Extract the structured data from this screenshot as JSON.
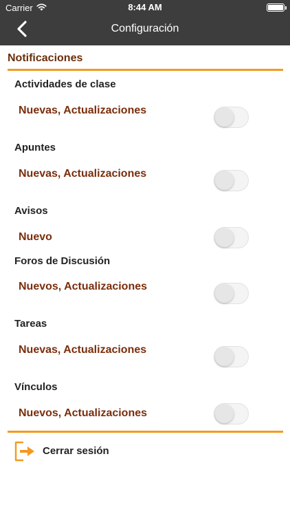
{
  "status_bar": {
    "carrier": "Carrier",
    "time": "8:44 AM",
    "wifi_icon": "wifi-icon",
    "battery_icon": "battery-icon"
  },
  "nav": {
    "title": "Configuración",
    "back_icon": "chevron-left-icon"
  },
  "section": {
    "title": "Notificaciones"
  },
  "groups": [
    {
      "label": "Actividades de clase",
      "option": "Nuevas, Actualizaciones",
      "enabled": false
    },
    {
      "label": "Apuntes",
      "option": "Nuevas, Actualizaciones",
      "enabled": false
    },
    {
      "label": "Avisos",
      "option": "Nuevo",
      "enabled": false
    },
    {
      "label": "Foros de Discusión",
      "option": "Nuevos, Actualizaciones",
      "enabled": false
    },
    {
      "label": "Tareas",
      "option": "Nuevas, Actualizaciones",
      "enabled": false
    },
    {
      "label": "Vínculos",
      "option": "Nuevos, Actualizaciones",
      "enabled": false
    }
  ],
  "logout": {
    "label": "Cerrar sesión",
    "icon": "logout-icon"
  },
  "colors": {
    "nav_bar": "#3d3d3d",
    "accent": "#f29a1f",
    "section_title": "#6b2e0a",
    "option_text": "#7a2e0c"
  }
}
